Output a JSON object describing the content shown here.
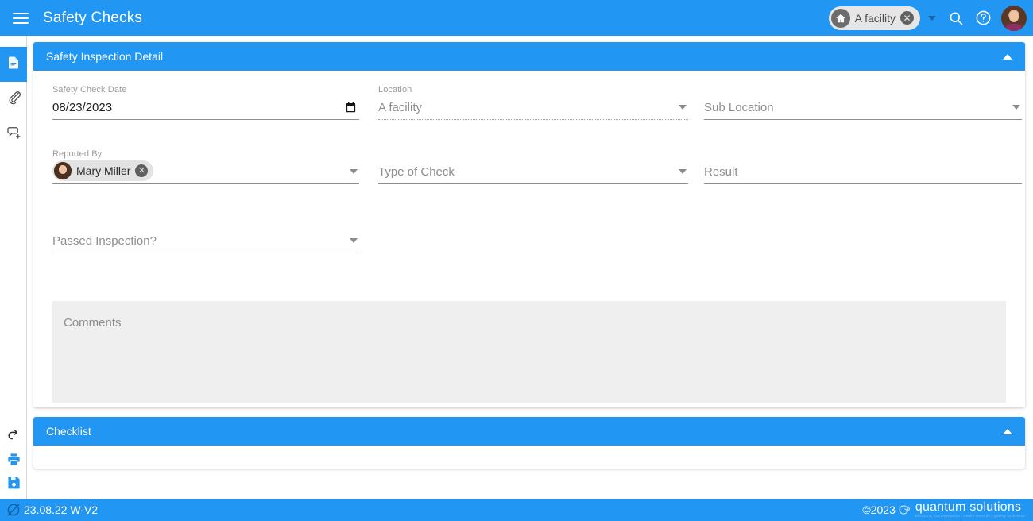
{
  "appbar": {
    "menu_icon": "hamburger-menu-icon",
    "title": "Safety Checks",
    "facility_chip": {
      "icon": "home-icon",
      "label": "A facility",
      "remove_icon": "close-circle-icon"
    },
    "caret_icon": "caret-down-icon",
    "search_icon": "search-icon",
    "help_icon": "help-circle-icon",
    "avatar_icon": "user-avatar"
  },
  "rail": {
    "top_items": [
      {
        "name": "document-icon",
        "label": "Document",
        "active": true
      },
      {
        "name": "paperclip-icon",
        "label": "Attachments",
        "active": false
      },
      {
        "name": "add-comment-icon",
        "label": "Add Comment",
        "active": false
      }
    ],
    "bottom_items": [
      {
        "name": "undo-icon",
        "label": "Undo",
        "color": "dark"
      },
      {
        "name": "print-icon",
        "label": "Print",
        "color": "blue"
      },
      {
        "name": "save-icon",
        "label": "Save",
        "color": "blue"
      }
    ]
  },
  "cards": {
    "detail": {
      "title": "Safety Inspection Detail",
      "collapse_icon": "chevron-up-icon"
    },
    "checklist": {
      "title": "Checklist",
      "collapse_icon": "chevron-up-icon"
    }
  },
  "fields": {
    "safety_check_date": {
      "label": "Safety Check Date",
      "value": "08/23/2023",
      "icon": "calendar-icon"
    },
    "location": {
      "label": "Location",
      "value": "A facility",
      "disabled": true,
      "icon": "caret-down-icon"
    },
    "sub_location": {
      "placeholder": "Sub Location",
      "value": "",
      "icon": "caret-down-icon"
    },
    "reported_by": {
      "label": "Reported By",
      "chip_name": "Mary Miller",
      "chip_remove_icon": "close-circle-icon",
      "icon": "caret-down-icon"
    },
    "type_of_check": {
      "placeholder": "Type of Check",
      "value": "",
      "icon": "caret-down-icon"
    },
    "result": {
      "placeholder": "Result",
      "value": ""
    },
    "passed_inspection": {
      "placeholder": "Passed Inspection?",
      "value": "",
      "icon": "caret-down-icon"
    },
    "comments": {
      "placeholder": "Comments",
      "value": ""
    }
  },
  "footer": {
    "badge_icon": "qs-logo-mark",
    "version": "23.08.22 W-V2",
    "copyright": "©2023",
    "brand_name": "quantum solutions",
    "brand_tagline": "Electronic Documentation  |  Health Records  |  Quality Assurance"
  },
  "colors": {
    "accent_blue": "#2196f3",
    "card_header_blue": "#2196f3",
    "comments_bg": "#efefef",
    "chip_bg": "#e3e3e3"
  }
}
